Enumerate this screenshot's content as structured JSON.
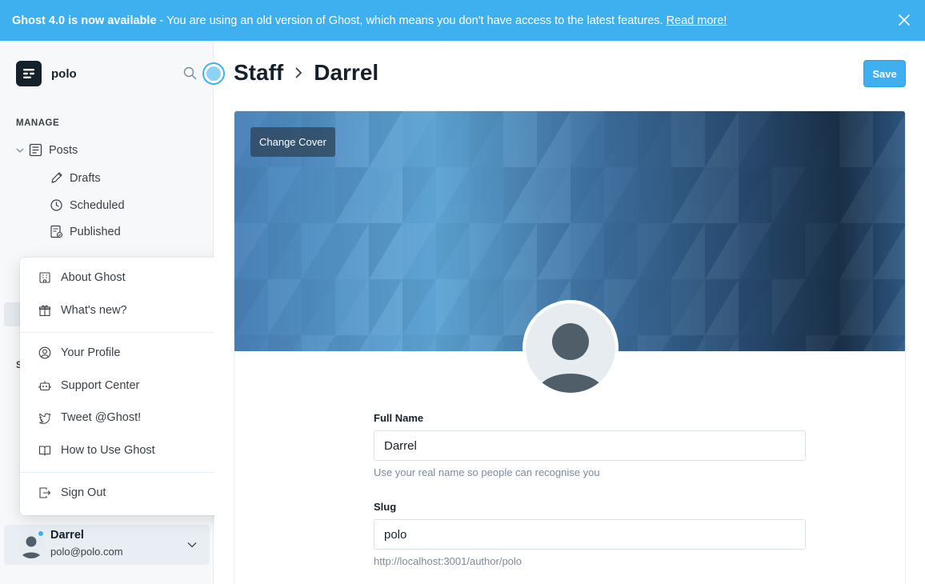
{
  "banner": {
    "title": "Ghost 4.0 is now available",
    "message": "- You are using an old version of Ghost, which means you don't have access to the latest features.",
    "link": "Read more!"
  },
  "sidebar": {
    "site_name": "polo",
    "section_manage": "MANAGE",
    "posts": "Posts",
    "drafts": "Drafts",
    "scheduled": "Scheduled",
    "published": "Published",
    "partial_section": "S"
  },
  "menu": {
    "about": "About Ghost",
    "whats_new": "What's new?",
    "profile": "Your Profile",
    "support": "Support Center",
    "tweet": "Tweet @Ghost!",
    "howto": "How to Use Ghost",
    "signout": "Sign Out"
  },
  "user": {
    "name": "Darrel",
    "email": "polo@polo.com"
  },
  "main": {
    "breadcrumb_parent": "Staff",
    "breadcrumb_current": "Darrel",
    "save_label": "Save",
    "change_cover": "Change Cover",
    "full_name_label": "Full Name",
    "full_name_value": "Darrel",
    "full_name_help": "Use your real name so people can recognise you",
    "slug_label": "Slug",
    "slug_value": "polo",
    "slug_help": "http://localhost:3001/author/polo"
  },
  "colors": {
    "accent": "#3eb0ef",
    "text": "#15212a",
    "sidebar_bg": "#f6f8fa"
  }
}
